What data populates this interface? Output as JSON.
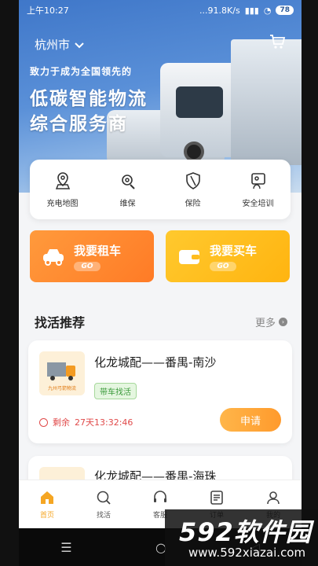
{
  "status": {
    "time": "上午10:27",
    "speed": "...91.8K/s",
    "battery": "78"
  },
  "banner": {
    "city": "杭州市",
    "tagline": "致力于成为全国领先的",
    "headline1": "低碳智能物流",
    "headline2": "综合服务商"
  },
  "quick_menu": [
    {
      "label": "充电地图",
      "icon": "map-pin-icon"
    },
    {
      "label": "维保",
      "icon": "gear-wrench-icon"
    },
    {
      "label": "保险",
      "icon": "shield-icon"
    },
    {
      "label": "安全培训",
      "icon": "training-icon"
    }
  ],
  "actions": {
    "rent": "我要租车",
    "buy": "我要买车",
    "go": "GO"
  },
  "section": {
    "title": "找活推荐",
    "more": "更多"
  },
  "jobs": [
    {
      "title": "化龙城配——番禺-南沙",
      "tag": "带车找活",
      "remain_label": "剩余",
      "remain_time": "27天13:32:46",
      "apply": "申请",
      "thumb_text": "九州弓箭物流"
    },
    {
      "title": "化龙城配——番禺-海珠"
    }
  ],
  "nav": [
    {
      "label": "首页",
      "icon": "home-icon"
    },
    {
      "label": "找活",
      "icon": "search-icon"
    },
    {
      "label": "客服",
      "icon": "headset-icon"
    },
    {
      "label": "订单",
      "icon": "list-icon"
    },
    {
      "label": "我的",
      "icon": "user-icon"
    }
  ],
  "watermark": {
    "brand": "592软件园",
    "url": "www.592xiazai.com"
  },
  "colors": {
    "accent": "#f5a623",
    "rent": "#ff8a2e",
    "buy": "#ffbd1f",
    "banner": "#4a82cf"
  }
}
